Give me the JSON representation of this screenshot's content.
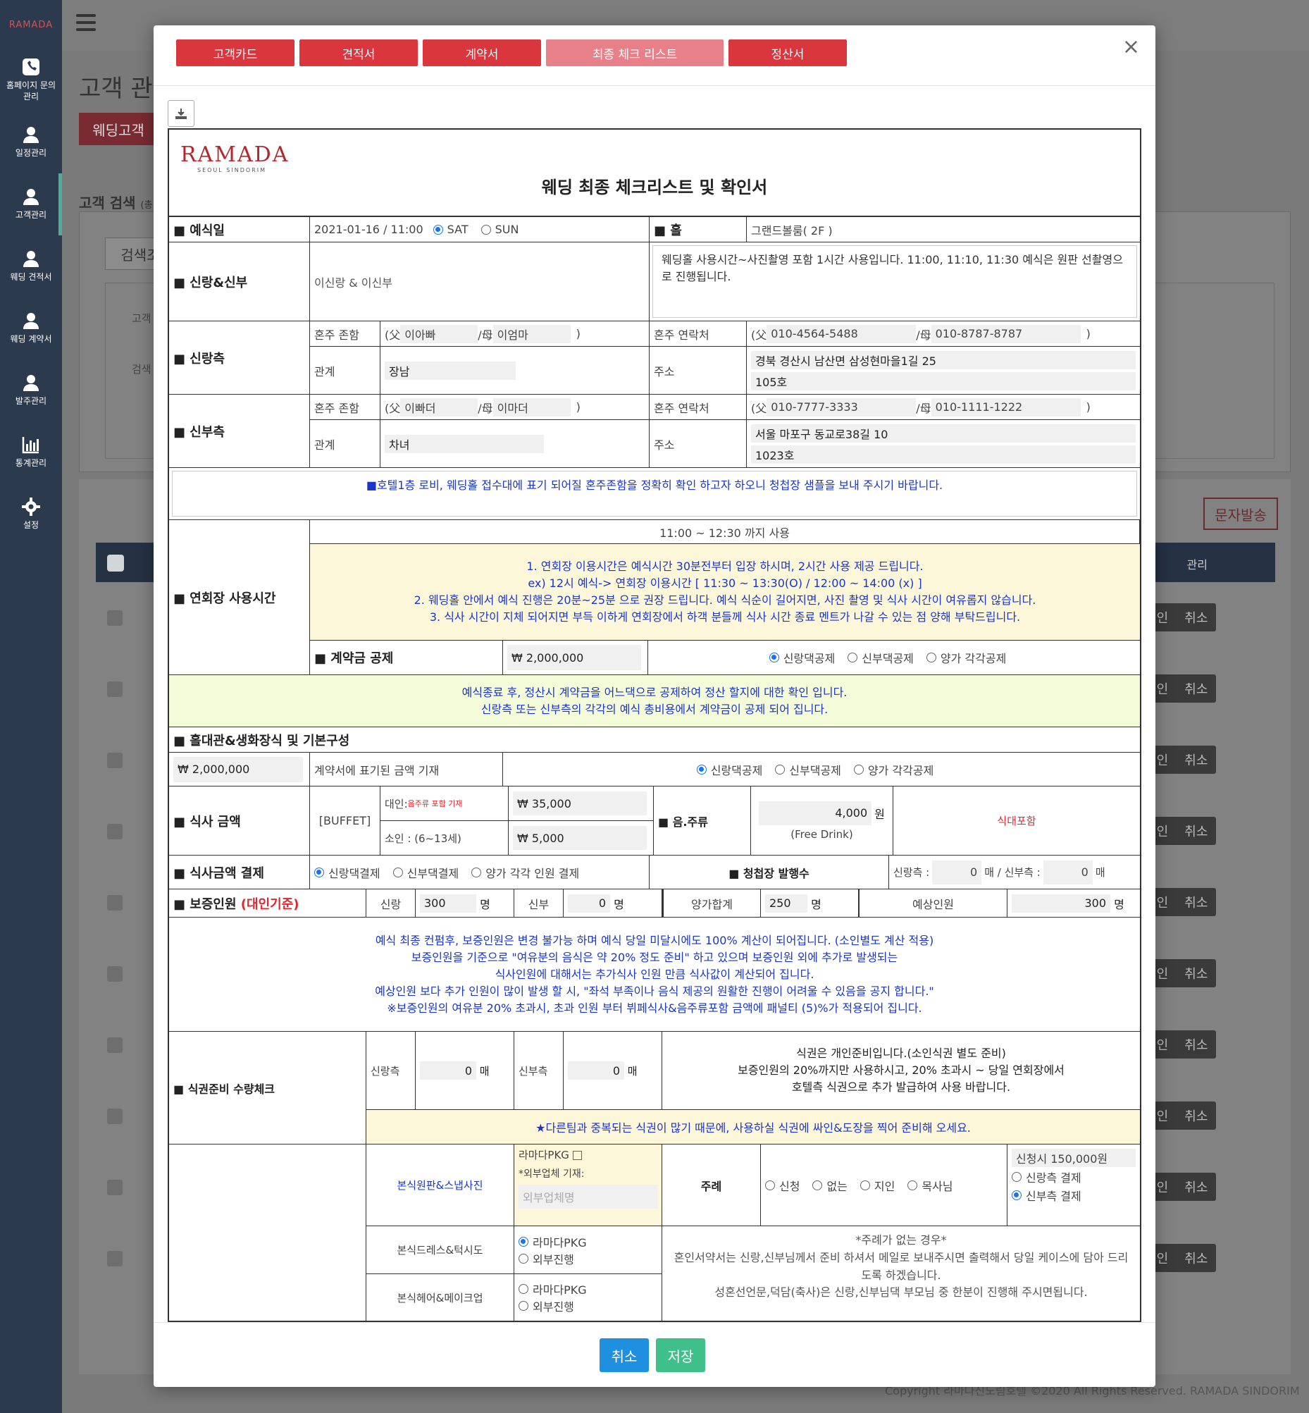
{
  "sidebar": {
    "logo": "RAMADA",
    "items": [
      {
        "label": "홈페이지 문의\n관리",
        "icon": "phone-icon"
      },
      {
        "label": "일정관리",
        "icon": "user-icon"
      },
      {
        "label": "고객관리",
        "icon": "user-icon"
      },
      {
        "label": "웨딩 견적서",
        "icon": "user-icon"
      },
      {
        "label": "웨딩 계약서",
        "icon": "user-icon"
      },
      {
        "label": "발주관리",
        "icon": "user-icon"
      },
      {
        "label": "통계관리",
        "icon": "chart-icon"
      },
      {
        "label": "설정",
        "icon": "gear-icon"
      }
    ]
  },
  "background": {
    "title": "고객 관",
    "wedding_btn": "웨딩고객",
    "search_label": "고객 검색",
    "search_label_small": "(총",
    "search_tab": "검색조",
    "field1": "고객",
    "field2": "검색",
    "sms_btn": "문자발송",
    "col_manage": "관리",
    "row_confirm": "인",
    "row_cancel": "취소",
    "footer": "Copyright 라마다신도림호텔 ©2020 All Rights Reserved. RAMADA SINDORIM"
  },
  "modal": {
    "tabs": [
      "고객카드",
      "견적서",
      "계약서",
      "최종 체크 리스트",
      "정산서"
    ],
    "close": "×",
    "doc_title": "웨딩 최종 체크리스트 및 확인서",
    "logo_main": "RAMADA",
    "logo_sub": "SEOUL SINDORIM",
    "wedding_date_label": "■ 예식일",
    "wedding_date": "2021-01-16 / 11:00",
    "day_sat": "SAT",
    "day_sun": "SUN",
    "hall_label": "■ 홀",
    "hall": "그랜드볼룸( 2F )",
    "couple_label": "■ 신랑&신부",
    "couple": "이신랑 & 이신부",
    "hall_note": "웨딩홀 사용시간~사진촬영 포함 1시간 사용입니다. 11:00, 11:10, 11:30 예식은 원판 선촬영으로 진행됩니다.",
    "groom_side_label": "■ 신랑측",
    "bride_side_label": "■ 신부측",
    "honju_name_label": "혼주 존함",
    "honju_contact_label": "혼주 연락처",
    "relation_label": "관계",
    "address_label": "주소",
    "father_prefix": "(父",
    "mother_prefix": "/母",
    "close_paren": ")",
    "groom": {
      "father": "이아빠",
      "mother": "이엄마",
      "father_tel": "010-4564-5488",
      "mother_tel": "010-8787-8787",
      "relation": "장남",
      "addr1": "경북 경산시 남산면 삼성현마을1길 25",
      "addr2": "105호"
    },
    "bride": {
      "father": "이빠더",
      "mother": "이마더",
      "father_tel": "010-7777-3333",
      "mother_tel": "010-1111-1222",
      "relation": "차녀",
      "addr1": "서울 마포구 동교로38길 10",
      "addr2": "1023호"
    },
    "lobby_note": "■호텔1층 로비, 웨딩홀 접수대에 표기 되어질 혼주존함을 정확히 확인 하고자 하오니 청첩장 샘플을 보내 주시기 바랍니다.",
    "banquet_label": "■ 연회장 사용시간",
    "banquet_time": "11:00 ~ 12:30 까지 사용",
    "banquet_notes": [
      "1. 연회장 이용시간은 예식시간 30분전부터 입장 하시며, 2시간 사용 제공 드립니다.",
      "ex) 12시 예식-> 연회장 이용시간 [ 11:30 ~ 13:30(O) / 12:00 ~ 14:00 (x) ]",
      "2. 웨딩홀 안에서 예식 진행은 20분~25분 으로 권장 드립니다. 예식 식순이 길어지면, 사진 촬영 및 식사 시간이 여유롭지 않습니다.",
      "3. 식사 시간이 지체 되어지면 부득 이하게 연회장에서 하객 분들께 식사 시간 종료 멘트가 나갈 수 있는 점 양해 부탁드립니다."
    ],
    "deposit_label": "■ 계약금 공제",
    "deposit": "₩  2,000,000",
    "opt_groom_deduct": "신랑댁공제",
    "opt_bride_deduct": "신부댁공제",
    "opt_both_deduct": "양가 각각공제",
    "deposit_notes": [
      "예식종료 후, 정산시 계약금을 어느댁으로 공제하여 정산 할지에 대한 확인 입니다.",
      "신랑측 또는 신부측의 각각의 예식 총비용에서 계약금이 공제 되어 집니다."
    ],
    "hall_rent_label": "■ 홀대관&생화장식 및 기본구성",
    "hall_rent": "₩ 2,000,000",
    "hall_rent_note": "계약서에 표기된 금액 기재",
    "meal_label": "■ 식사 금액",
    "buffet": "[BUFFET]",
    "adult_label": "대인:",
    "adult_note": "음주류 포함 기재",
    "adult_price": "₩ 35,000",
    "child_label": "소인 : (6~13세)",
    "child_price": "₩ 5,000",
    "drink_label": "■ 음.주류",
    "drink_price": "4,000",
    "won": "원",
    "free_drink": "(Free Drink)",
    "meal_included": "식대포함",
    "meal_pay_label": "■ 식사금액 결제",
    "opt_groom_pay": "신랑댁결제",
    "opt_bride_pay": "신부댁결제",
    "opt_both_pay": "양가 각각 인원 결제",
    "invitation_label": "■ 청첩장 발행수",
    "groom_side": "신랑측 :",
    "bride_side_sep": "매 / 신부측 :",
    "inv_groom": "0",
    "inv_bride": "0",
    "unit_sheet": "매",
    "guarantee_label": "■ 보증인원",
    "guarantee_suffix": "(대인기준)",
    "groom_word": "신랑",
    "bride_word": "신부",
    "g_groom": "300",
    "g_bride": "0",
    "unit_person": "명",
    "both_total_label": "양가합계",
    "both_total": "250",
    "expected_label": "예상인원",
    "expected": "300",
    "guarantee_notes": [
      "예식 최종 컨펌후, 보증인원은 변경 불가능 하며 예식 당일 미달시에도 100% 계산이 되어집니다. (소인별도 계산 적용)",
      "보증인원을 기준으로  \"여유분의 음식은 약 20% 정도 준비\" 하고 있으며 보증인원 외에 추가로 발생되는",
      "식사인원에 대해서는 추가식사 인원 만큼 식사값이 계산되어 집니다.",
      "예상인원 보다 추가 인원이 많이 발생 할 시, \"좌석 부족이나 음식 제공의 원활한 진행이 어려울 수 있음을 공지 합니다.\"",
      "※보증인원의 여유분 20% 초과시, 초과 인원 부터 뷔페식사&음주류포함 금액에 패널티 (5)%가 적용되어 집니다."
    ],
    "ticket_label": "■ 식권준비 수량체크",
    "groom_side_word": "신랑측",
    "bride_side_word": "신부측",
    "ticket_groom": "0",
    "ticket_bride": "0",
    "ticket_notes": [
      "식권은 개인준비입니다.(소인식권 별도 준비)",
      "보증인원의 20%까지만 사용하시고, 20% 초과시 ~ 당일 연회장에서",
      "호텔측 식권으로 추가 발급하여 사용 바랍니다."
    ],
    "ticket_warning": "★다른팀과 중복되는 식권이 많기 때문에, 사용하실 식권에 싸인&도장을 찍어 준비해 오세요.",
    "photo_label": "본식원판&스냅사진",
    "ramada_pkg_cb": "라마다PKG",
    "outside_vendor_note": "*외부업체 기재:",
    "outside_vendor_ph": "외부업체명",
    "officiant_label": "주례",
    "off_apply": "신청",
    "off_none": "없는",
    "off_friend": "지인",
    "off_pastor": "목사님",
    "off_fee": "신청시 150,000원",
    "off_groom_pay": "신랑측 결제",
    "off_bride_pay": "신부측 결제",
    "dress_label": "본식드레스&턱시도",
    "hair_label": "본식헤어&메이크업",
    "opt_ramada": "라마다PKG",
    "opt_outside": "외부진행",
    "no_officiant_notes": [
      "*주례가 없는 경우*",
      "혼인서약서는 신랑,신부님께서 준비 하셔서 메일로 보내주시면 출력해서 당일 케이스에 담아 드리도록 하겠습니다.",
      "성혼선언문,덕담(축사)은 신랑,신부님댁 부모님 중 한분이 진행해 주시면됩니다."
    ],
    "cancel_btn": "취소",
    "save_btn": "저장",
    "colors": {
      "tab": "#d9363e",
      "tab_active": "#e8808a",
      "cancel": "#1f8fe0",
      "save": "#3fbf8a"
    }
  }
}
